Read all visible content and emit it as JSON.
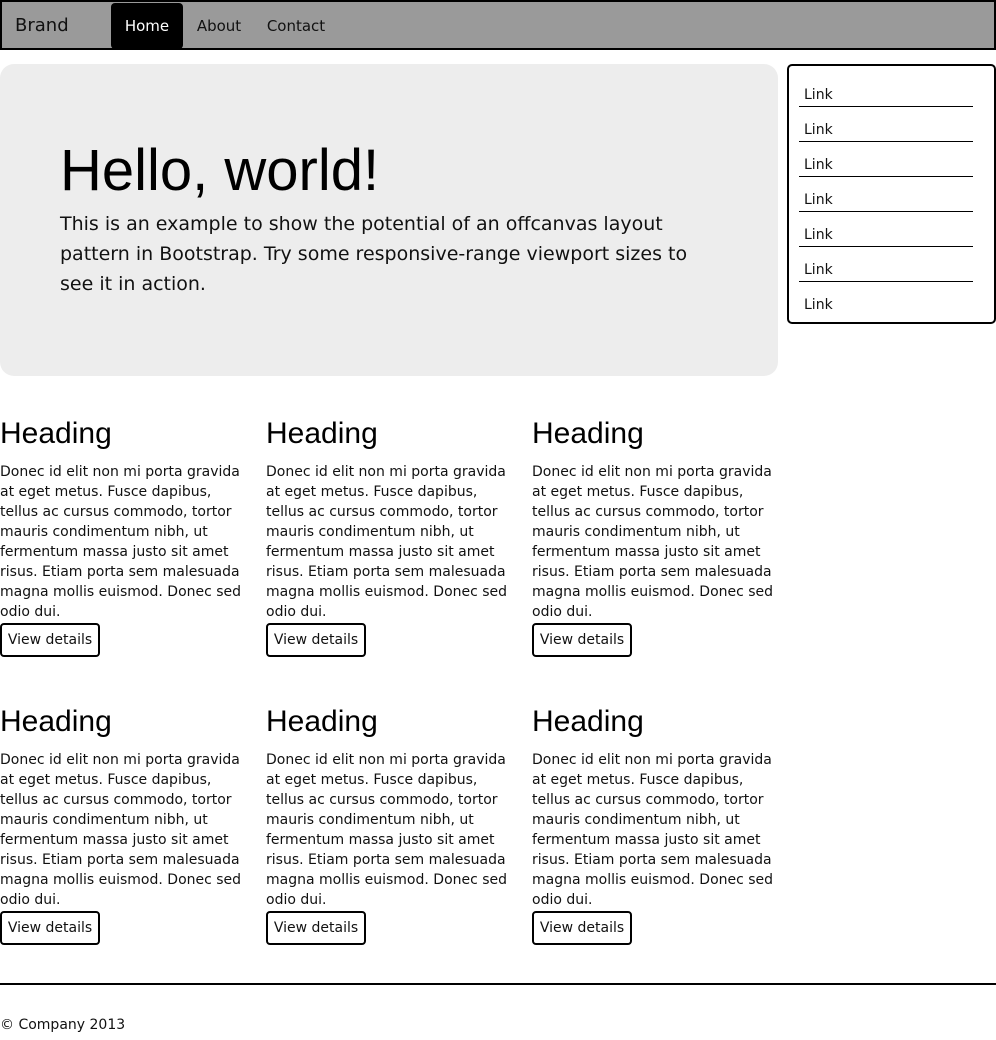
{
  "navbar": {
    "brand": "Brand",
    "items": [
      {
        "label": "Home",
        "active": true
      },
      {
        "label": "About",
        "active": false
      },
      {
        "label": "Contact",
        "active": false
      }
    ]
  },
  "jumbotron": {
    "title": "Hello, world!",
    "text": "This is an example to show the potential of an offcanvas layout pattern in Bootstrap. Try some responsive-range viewport sizes to see it in action."
  },
  "sidebar": {
    "links": [
      "Link",
      "Link",
      "Link",
      "Link",
      "Link",
      "Link",
      "Link"
    ]
  },
  "features": [
    {
      "heading": "Heading",
      "body": "Donec id elit non mi porta gravida at eget metus. Fusce dapibus, tellus ac cursus commodo, tortor mauris condimentum nibh, ut fermentum massa justo sit amet risus. Etiam porta sem malesuada magna mollis euismod. Donec sed odio dui.",
      "button": "View details"
    },
    {
      "heading": "Heading",
      "body": "Donec id elit non mi porta gravida at eget metus. Fusce dapibus, tellus ac cursus commodo, tortor mauris condimentum nibh, ut fermentum massa justo sit amet risus. Etiam porta sem malesuada magna mollis euismod. Donec sed odio dui.",
      "button": "View details"
    },
    {
      "heading": "Heading",
      "body": "Donec id elit non mi porta gravida at eget metus. Fusce dapibus, tellus ac cursus commodo, tortor mauris condimentum nibh, ut fermentum massa justo sit amet risus. Etiam porta sem malesuada magna mollis euismod. Donec sed odio dui.",
      "button": "View details"
    },
    {
      "heading": "Heading",
      "body": "Donec id elit non mi porta gravida at eget metus. Fusce dapibus, tellus ac cursus commodo, tortor mauris condimentum nibh, ut fermentum massa justo sit amet risus. Etiam porta sem malesuada magna mollis euismod. Donec sed odio dui.",
      "button": "View details"
    },
    {
      "heading": "Heading",
      "body": "Donec id elit non mi porta gravida at eget metus. Fusce dapibus, tellus ac cursus commodo, tortor mauris condimentum nibh, ut fermentum massa justo sit amet risus. Etiam porta sem malesuada magna mollis euismod. Donec sed odio dui.",
      "button": "View details"
    },
    {
      "heading": "Heading",
      "body": "Donec id elit non mi porta gravida at eget metus. Fusce dapibus, tellus ac cursus commodo, tortor mauris condimentum nibh, ut fermentum massa justo sit amet risus. Etiam porta sem malesuada magna mollis euismod. Donec sed odio dui.",
      "button": "View details"
    }
  ],
  "footer": {
    "text": "© Company 2013"
  },
  "colors": {
    "navbar_background": "#9a9a9a",
    "active_nav_background": "#000000",
    "jumbotron_background": "#ededed"
  }
}
